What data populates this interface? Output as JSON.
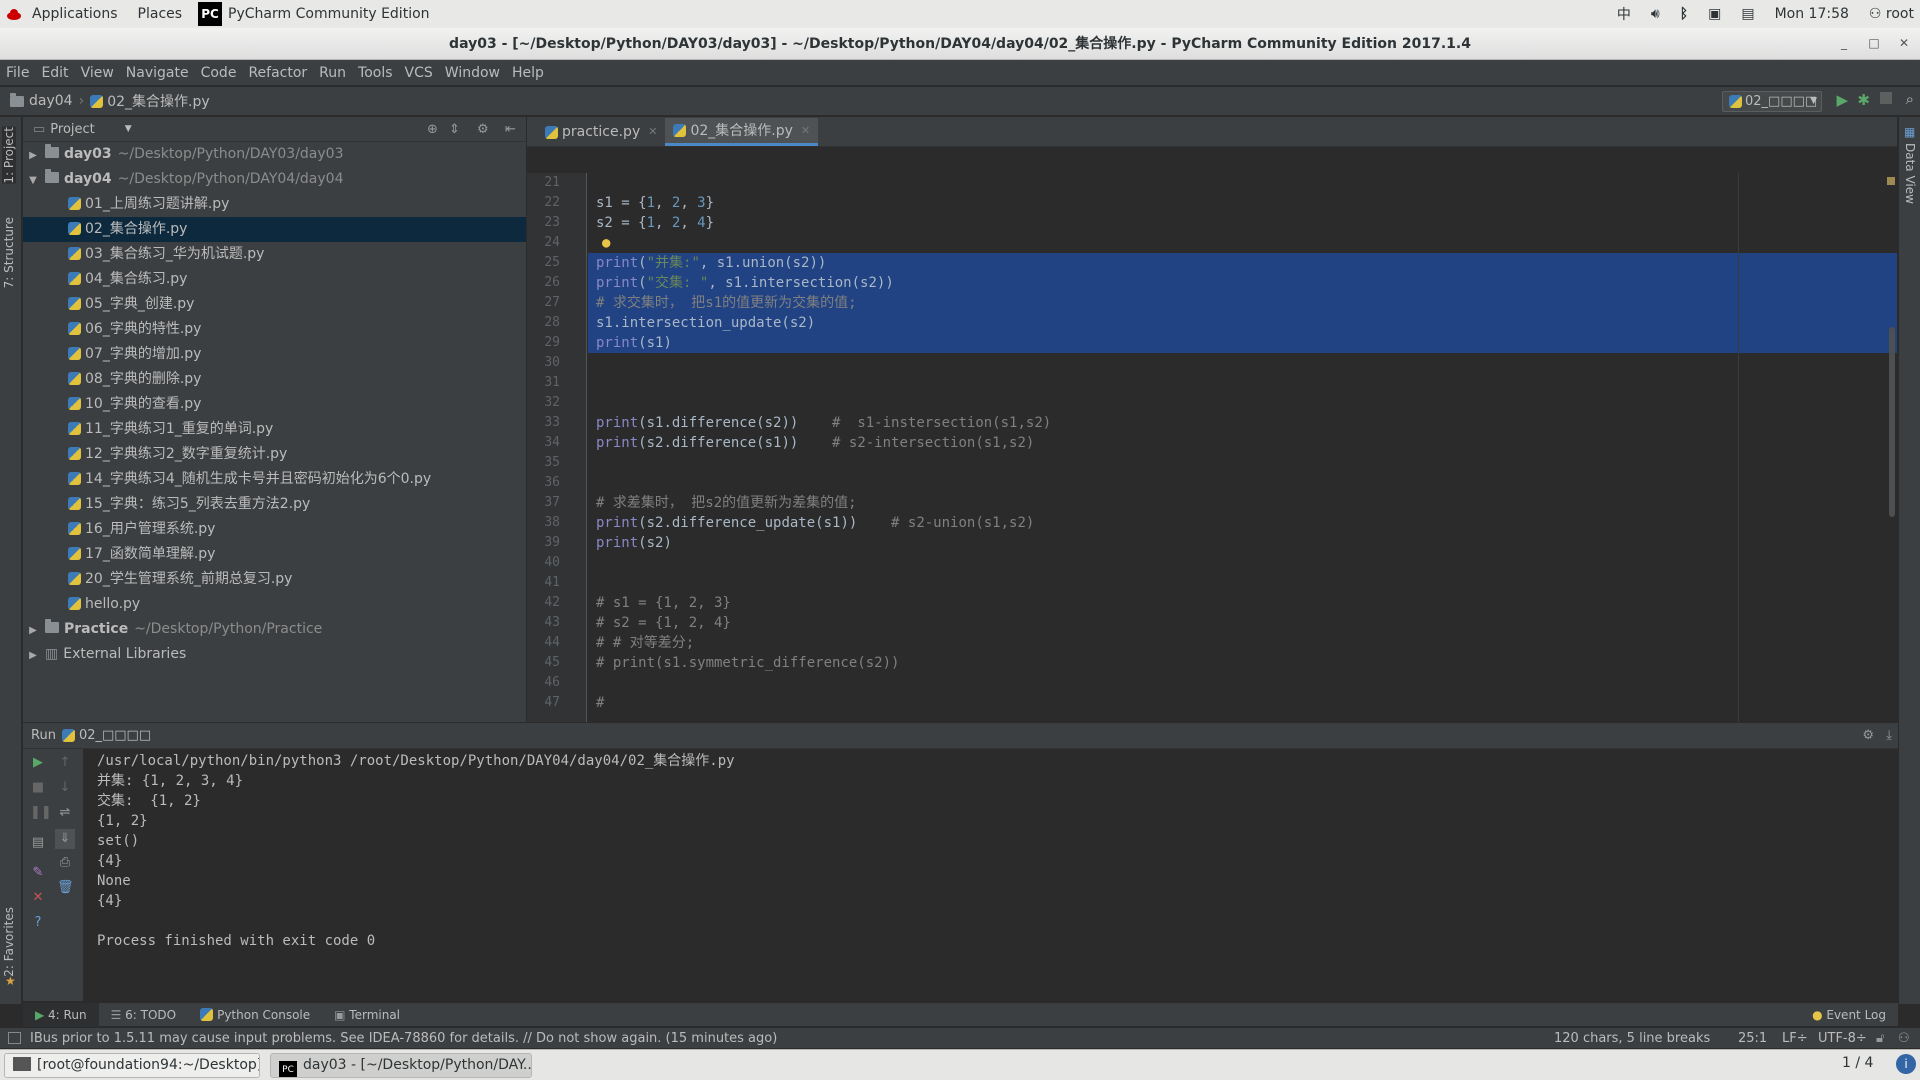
{
  "gnome": {
    "applications": "Applications",
    "places": "Places",
    "app_name": "PyCharm Community Edition",
    "ime": "中",
    "clock": "Mon 17:58",
    "user": "root"
  },
  "window": {
    "title": "day03 - [~/Desktop/Python/DAY03/day03] - ~/Desktop/Python/DAY04/day04/02_集合操作.py - PyCharm Community Edition 2017.1.4"
  },
  "menu": [
    "File",
    "Edit",
    "View",
    "Navigate",
    "Code",
    "Refactor",
    "Run",
    "Tools",
    "VCS",
    "Window",
    "Help"
  ],
  "navbar": {
    "crumb_folder": "day04",
    "crumb_file": "02_集合操作.py",
    "run_config": "02_□□□□"
  },
  "left_strip": {
    "project": "1: Project",
    "structure": "7: Structure",
    "favorites": "2: Favorites"
  },
  "right_strip": {
    "data_view": "Data View"
  },
  "project": {
    "header": "Project",
    "roots": [
      {
        "name": "day03",
        "path": "~/Desktop/Python/DAY03/day03"
      },
      {
        "name": "day04",
        "path": "~/Desktop/Python/DAY04/day04"
      }
    ],
    "files": [
      "01_上周练习题讲解.py",
      "02_集合操作.py",
      "03_集合练习_华为机试题.py",
      "04_集合练习.py",
      "05_字典_创建.py",
      "06_字典的特性.py",
      "07_字典的增加.py",
      "08_字典的删除.py",
      "10_字典的查看.py",
      "11_字典练习1_重复的单词.py",
      "12_字典练习2_数字重复统计.py",
      "14_字典练习4_随机生成卡号并且密码初始化为6个0.py",
      "15_字典：练习5_列表去重方法2.py",
      "16_用户管理系统.py",
      "17_函数简单理解.py",
      "20_学生管理系统_前期总复习.py",
      "hello.py"
    ],
    "practice": {
      "name": "Practice",
      "path": "~/Desktop/Python/Practice"
    },
    "external": "External Libraries"
  },
  "tabs": [
    {
      "label": "practice.py"
    },
    {
      "label": "02_集合操作.py"
    }
  ],
  "editor": {
    "line_numbers": [
      "21",
      "22",
      "23",
      "24",
      "25",
      "26",
      "27",
      "28",
      "29",
      "30",
      "31",
      "32",
      "33",
      "34",
      "35",
      "36",
      "37",
      "38",
      "39",
      "40",
      "41",
      "42",
      "43",
      "44",
      "45",
      "46",
      "47"
    ]
  },
  "run": {
    "header_label": "Run",
    "header_config": "02_□□□□",
    "output": [
      "/usr/local/python/bin/python3 /root/Desktop/Python/DAY04/day04/02_集合操作.py",
      "并集: {1, 2, 3, 4}",
      "交集:  {1, 2}",
      "{1, 2}",
      "set()",
      "{4}",
      "None",
      "{4}",
      "",
      "Process finished with exit code 0"
    ]
  },
  "bottom_tabs": {
    "run": "4: Run",
    "todo": "6: TODO",
    "python_console": "Python Console",
    "terminal": "Terminal",
    "event_log": "Event Log"
  },
  "status": {
    "message": "IBus prior to 1.5.11 may cause input problems. See IDEA-78860 for details. // Do not show again. (15 minutes ago)",
    "selection": "120 chars, 5 line breaks",
    "position": "25:1",
    "line_sep": "LF÷",
    "encoding": "UTF-8÷"
  },
  "taskbar": {
    "task1": "[root@foundation94:~/Desktop]",
    "task2": "day03 - [~/Desktop/Python/DAY...",
    "workspace": "1 / 4"
  }
}
